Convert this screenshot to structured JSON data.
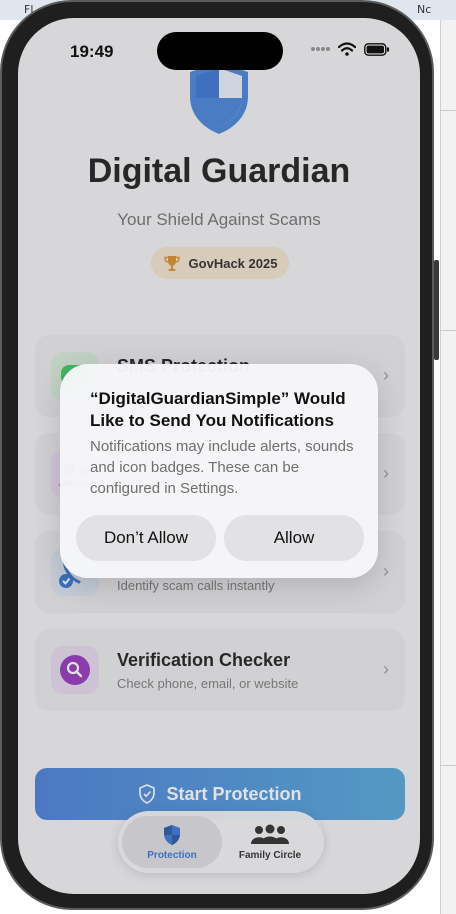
{
  "desktop": {
    "tab_left": "Fl",
    "tab_right": "Nc"
  },
  "status_bar": {
    "time": "19:49",
    "icons": [
      "signal-dots-icon",
      "wifi-icon",
      "battery-icon"
    ]
  },
  "app": {
    "title": "Digital Guardian",
    "subtitle": "Your Shield Against Scams",
    "badge": {
      "icon": "trophy-icon",
      "label": "GovHack 2025"
    },
    "cards": [
      {
        "icon": "sms-icon",
        "title": "SMS Protection",
        "subtitle": "",
        "color": "#34c759"
      },
      {
        "icon": "people-icon",
        "title": "",
        "subtitle": "",
        "color": "#af52de"
      },
      {
        "icon": "call-check-icon",
        "title": "",
        "subtitle": "Identify scam calls instantly",
        "color": "#2f6fd4"
      },
      {
        "icon": "magnifier-icon",
        "title": "Verification Checker",
        "subtitle": "Check phone, email, or website",
        "color": "#8e2db8"
      }
    ],
    "start_button": "Start Protection",
    "tabs": [
      {
        "label": "Protection",
        "icon": "shield-icon"
      },
      {
        "label": "Family Circle",
        "icon": "family-icon"
      }
    ]
  },
  "alert": {
    "title": "“DigitalGuardianSimple” Would Like to Send You Notifications",
    "message": "Notifications may include alerts, sounds and icon badges. These can be configured in Settings.",
    "deny_label": "Don’t Allow",
    "allow_label": "Allow"
  },
  "colors": {
    "accent": "#2f6fd4",
    "start_gradient_start": "#3f79d8",
    "start_gradient_end": "#4aa3d8",
    "badge_bg": "#f3e3cc"
  }
}
